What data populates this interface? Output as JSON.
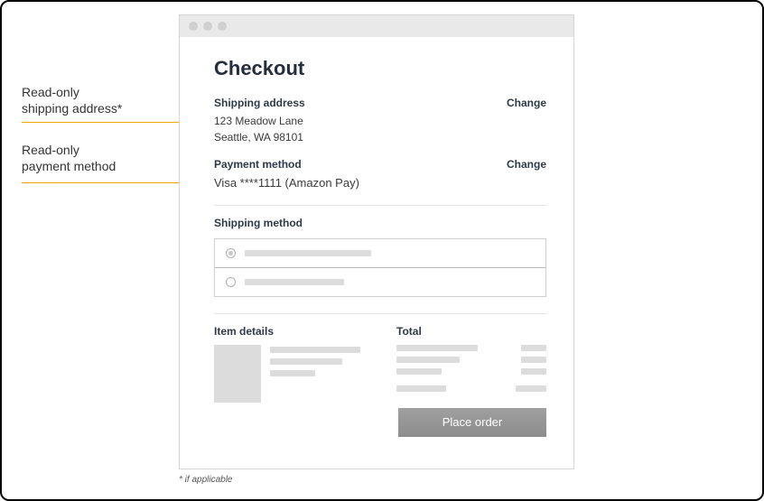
{
  "annotations": {
    "a1_line1": "Read-only",
    "a1_line2": "shipping address*",
    "a2_line1": "Read-only",
    "a2_line2": "payment method"
  },
  "page": {
    "title": "Checkout"
  },
  "shipping": {
    "label": "Shipping address",
    "change": "Change",
    "line1": "123 Meadow Lane",
    "line2": "Seattle, WA 98101"
  },
  "payment": {
    "label": "Payment method",
    "change": "Change",
    "value": "Visa ****1111 (Amazon Pay)"
  },
  "shipping_method": {
    "label": "Shipping method"
  },
  "item_details": {
    "label": "Item details"
  },
  "total": {
    "label": "Total"
  },
  "cta": {
    "place_order": "Place order"
  },
  "footnote": "* if applicable"
}
